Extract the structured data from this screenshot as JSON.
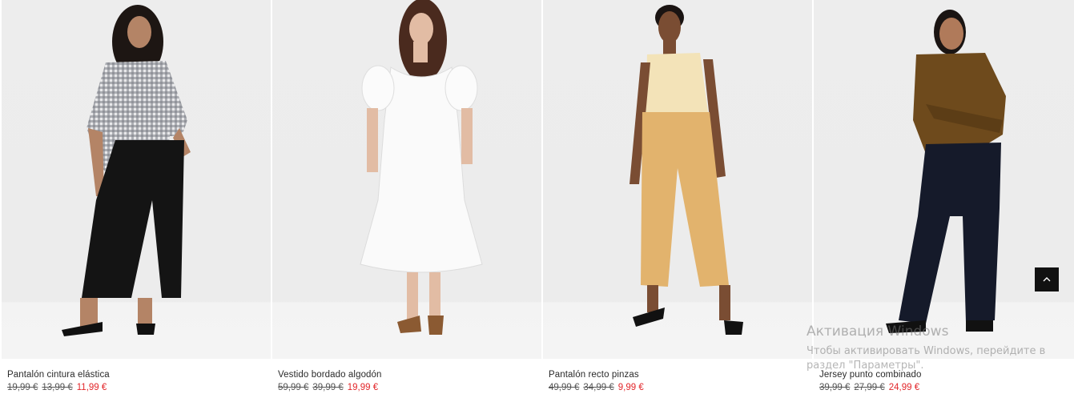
{
  "products": [
    {
      "name": "Pantalón cintura elástica",
      "price_original": "19,99 €",
      "price_previous": "13,99 €",
      "price_sale": "11,99 €"
    },
    {
      "name": "Vestido bordado algodón",
      "price_original": "59,99 €",
      "price_previous": "39,99 €",
      "price_sale": "19,99 €"
    },
    {
      "name": "Pantalón recto pinzas",
      "price_original": "49,99 €",
      "price_previous": "34,99 €",
      "price_sale": "9,99 €"
    },
    {
      "name": "Jersey punto combinado",
      "price_original": "39,99 €",
      "price_previous": "27,99 €",
      "price_sale": "24,99 €"
    }
  ],
  "scroll_top": {
    "icon": "chevron-up-icon"
  },
  "watermark": {
    "title": "Активация Windows",
    "text": "Чтобы активировать Windows, перейдите в раздел \"Параметры\"."
  },
  "colors": {
    "sale_price": "#e2262a",
    "scroll_button_bg": "#111111",
    "photo_background": "#ededed"
  }
}
